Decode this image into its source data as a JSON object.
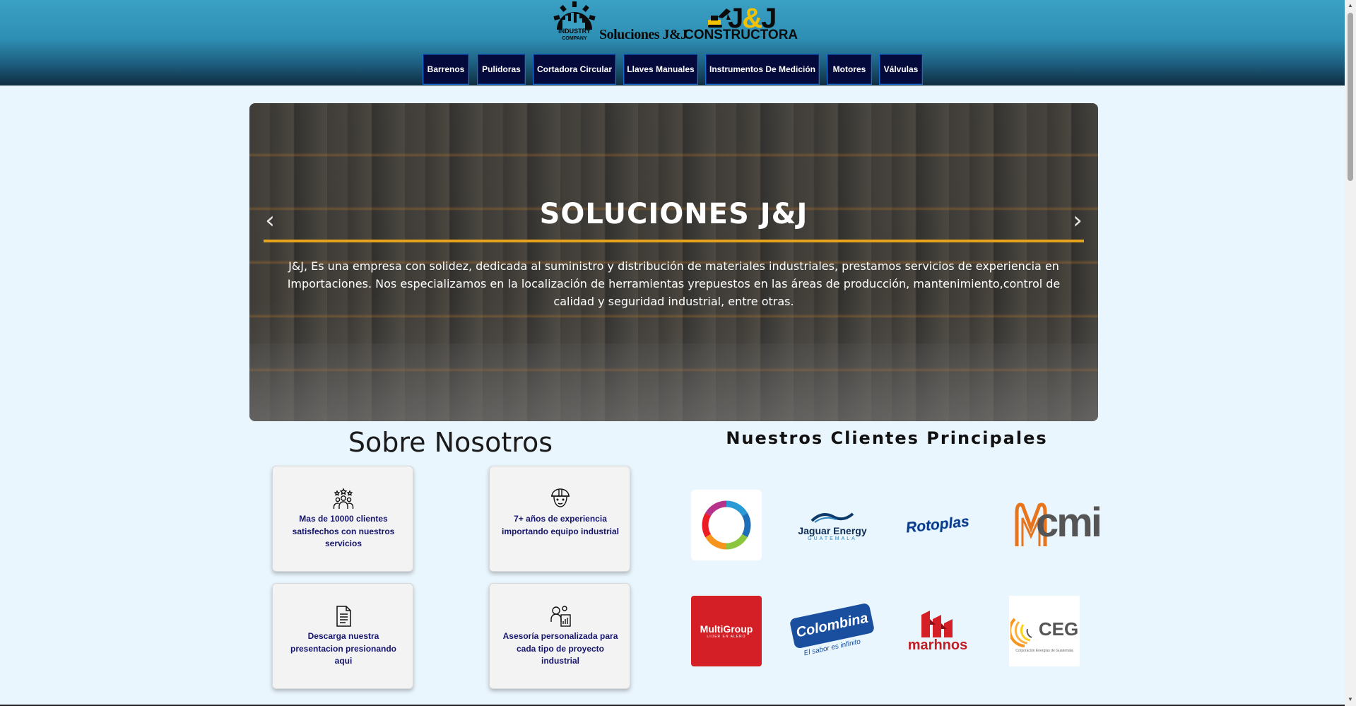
{
  "header": {
    "logo_industry": {
      "top_text": "INDUSTRY",
      "bottom_text": "COMPANY",
      "name": "Soluciones J&J"
    },
    "logo_jj": {
      "jj": "J",
      "amp": "&",
      "jj2": "J",
      "constructora": "CONSTRUCTORA"
    }
  },
  "nav": {
    "items": [
      {
        "label": "Barrenos"
      },
      {
        "label": "Pulidoras"
      },
      {
        "label": "Cortadora Circular"
      },
      {
        "label": "Llaves Manuales"
      },
      {
        "label": "Instrumentos De Medición"
      },
      {
        "label": "Motores"
      },
      {
        "label": "Válvulas"
      }
    ]
  },
  "hero": {
    "title": "SOLUCIONES J&J",
    "description": "J&J, Es una empresa con solidez, dedicada al suministro y distribución de materiales industriales, prestamos servicios de experiencia en Importaciones. Nos especializamos en la localización de herramientas yrepuestos en las áreas de producción, mantenimiento,control de calidad y seguridad industrial, entre otras.",
    "prev_arrow": "‹",
    "next_arrow": "›"
  },
  "about": {
    "title": "Sobre Nosotros",
    "cards": [
      {
        "text": "Mas de 10000 clientes satisfechos con nuestros servicios",
        "icon": "users-stars-icon"
      },
      {
        "text": "7+ años de experiencia importando equipo industrial",
        "icon": "worker-helmet-icon"
      },
      {
        "text": "Descarga nuestra presentacion presionando aqui",
        "icon": "document-icon"
      },
      {
        "text": "Asesoría personalizada para cada tipo de proyecto industrial",
        "icon": "consulting-icon"
      }
    ]
  },
  "clients": {
    "title": "Nuestros Clientes Principales",
    "logos": [
      {
        "name": "",
        "icon": "ring-logo"
      },
      {
        "name": "Jaguar Energy",
        "sub": "GUATEMALA"
      },
      {
        "name": "Rotoplas"
      },
      {
        "name": "cmi"
      },
      {
        "name": "MultiGroup",
        "sub": "LIDER EN ALERO"
      },
      {
        "name": "Colombina",
        "sub": "El sabor es infinito"
      },
      {
        "name": "marhnos"
      },
      {
        "name": "CEG",
        "sub": "Corporación Energías de Guatemala"
      }
    ]
  },
  "colors": {
    "nav_bg": "#050a3c",
    "accent_line": "#e6a21b",
    "card_text": "#15156e",
    "page_bg": "#eaf6fd"
  }
}
